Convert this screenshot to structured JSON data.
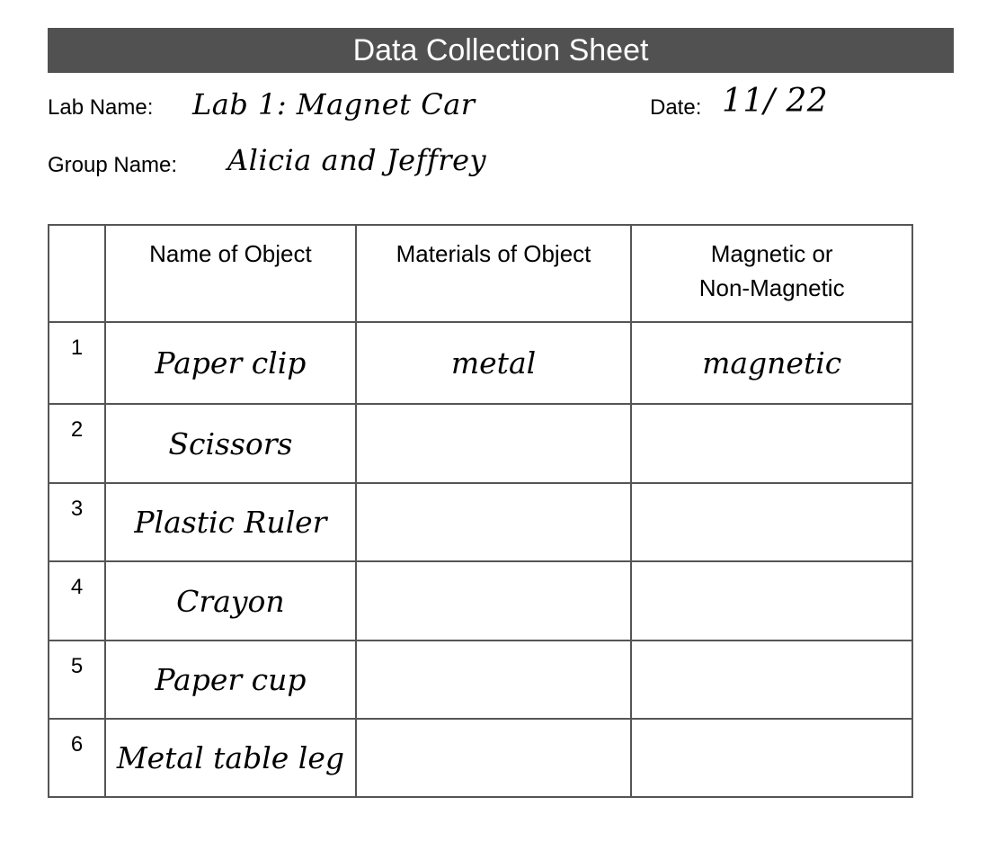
{
  "header": {
    "title": "Data Collection Sheet",
    "lab_name_label": "Lab Name:",
    "lab_name_value": "Lab 1: Magnet Car",
    "date_label": "Date:",
    "date_value": "11/ 22",
    "group_name_label": "Group Name:",
    "group_name_value": "Alicia and Jeffrey"
  },
  "colors": {
    "title_bar": "#515151",
    "table_border": "#555555"
  },
  "table": {
    "columns": [
      "",
      "Name of Object",
      "Materials of Object",
      "Magnetic or Non-Magnetic"
    ],
    "column_lines": {
      "magnetic_line1": "Magnetic or",
      "magnetic_line2": "Non-Magnetic"
    },
    "rows": [
      {
        "num": "1",
        "name": "Paper clip",
        "material": "metal",
        "magnetic": "magnetic"
      },
      {
        "num": "2",
        "name": "Scissors",
        "material": "",
        "magnetic": ""
      },
      {
        "num": "3",
        "name": "Plastic Ruler",
        "material": "",
        "magnetic": ""
      },
      {
        "num": "4",
        "name": "Crayon",
        "material": "",
        "magnetic": ""
      },
      {
        "num": "5",
        "name": "Paper cup",
        "material": "",
        "magnetic": ""
      },
      {
        "num": "6",
        "name": "Metal table leg",
        "material": "",
        "magnetic": ""
      }
    ]
  }
}
